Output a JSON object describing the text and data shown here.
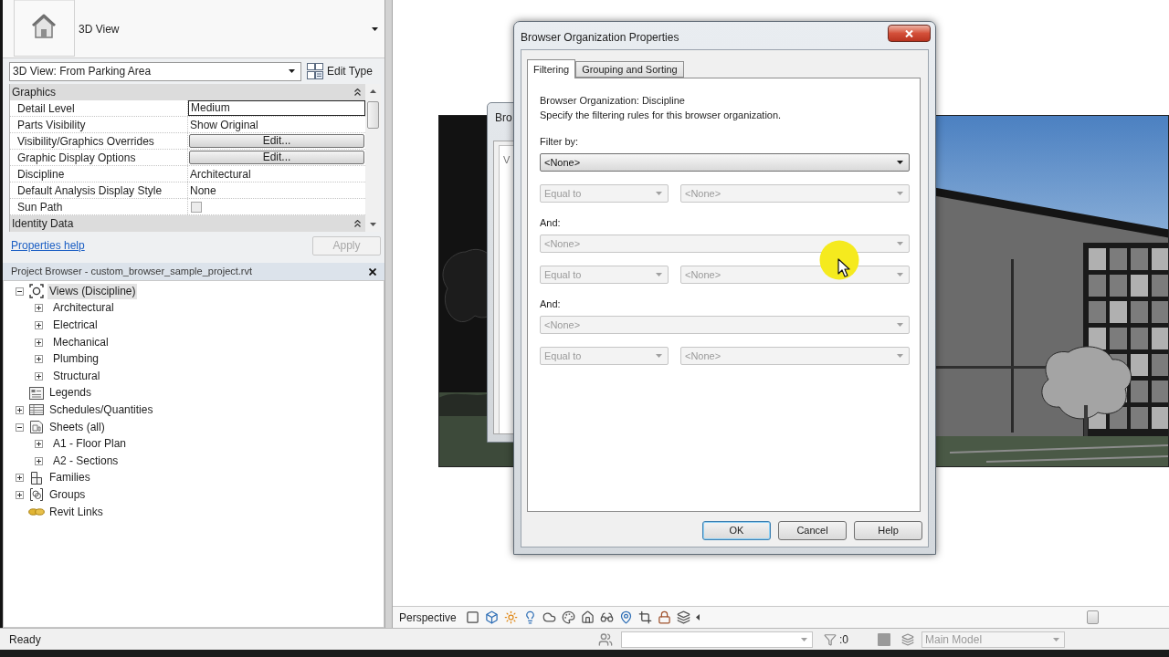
{
  "properties": {
    "type_selector": {
      "label": "3D View"
    },
    "instance_dropdown": {
      "value": "3D View: From Parking Area"
    },
    "edit_type_button": {
      "label": "Edit Type"
    },
    "groups": [
      {
        "title": "Graphics",
        "expanded": true,
        "rows": [
          {
            "label": "Detail Level",
            "kind": "field",
            "value": "Medium"
          },
          {
            "label": "Parts Visibility",
            "kind": "text",
            "value": "Show Original"
          },
          {
            "label": "Visibility/Graphics Overrides",
            "kind": "button",
            "value": "Edit..."
          },
          {
            "label": "Graphic Display Options",
            "kind": "button",
            "value": "Edit..."
          },
          {
            "label": "Discipline",
            "kind": "text",
            "value": "Architectural"
          },
          {
            "label": "Default Analysis Display Style",
            "kind": "text",
            "value": "None"
          },
          {
            "label": "Sun Path",
            "kind": "checkbox",
            "checked": false
          }
        ]
      },
      {
        "title": "Identity Data",
        "expanded": true
      }
    ],
    "help_link": "Properties help",
    "apply_button": {
      "label": "Apply",
      "disabled": true
    }
  },
  "project_browser": {
    "title": "Project Browser - custom_browser_sample_project.rvt",
    "tree": [
      {
        "label": "Views (Discipline)",
        "kind": "views",
        "expanded": true,
        "selected": true,
        "children": [
          {
            "label": "Architectural",
            "expanded": false,
            "selected": false
          },
          {
            "label": "Electrical",
            "expanded": false,
            "selected": false
          },
          {
            "label": "Mechanical",
            "expanded": false,
            "selected": false
          },
          {
            "label": "Plumbing",
            "expanded": false,
            "selected": false
          },
          {
            "label": "Structural",
            "expanded": false,
            "selected": false
          }
        ]
      },
      {
        "label": "Legends",
        "kind": "legends",
        "selected": false
      },
      {
        "label": "Schedules/Quantities",
        "kind": "schedules",
        "expanded": false,
        "selected": false
      },
      {
        "label": "Sheets (all)",
        "kind": "sheets",
        "expanded": true,
        "selected": false,
        "children": [
          {
            "label": "A1 - Floor Plan",
            "expanded": false,
            "selected": false
          },
          {
            "label": "A2 - Sections",
            "expanded": false,
            "selected": false
          }
        ]
      },
      {
        "label": "Families",
        "kind": "families",
        "expanded": false,
        "selected": false
      },
      {
        "label": "Groups",
        "kind": "groups",
        "expanded": false,
        "selected": false
      },
      {
        "label": "Revit Links",
        "kind": "links",
        "selected": false
      }
    ]
  },
  "view_bar": {
    "label": "Perspective"
  },
  "background_dialog": {
    "title": "Bro",
    "content": "V"
  },
  "dialog": {
    "title": "Browser Organization Properties",
    "tabs": [
      {
        "label": "Filtering",
        "selected": true
      },
      {
        "label": "Grouping and Sorting",
        "selected": false
      }
    ],
    "heading": "Browser Organization: Discipline",
    "description": "Specify the filtering rules for this browser organization.",
    "rules": [
      {
        "label": "Filter by:",
        "field": {
          "value": "<None>",
          "disabled": false
        },
        "operator": {
          "value": "Equal to",
          "disabled": true
        },
        "operand": {
          "value": "<None>",
          "disabled": true
        }
      },
      {
        "label": "And:",
        "field": {
          "value": "<None>",
          "disabled": true
        },
        "operator": {
          "value": "Equal to",
          "disabled": true
        },
        "operand": {
          "value": "<None>",
          "disabled": true
        }
      },
      {
        "label": "And:",
        "field": {
          "value": "<None>",
          "disabled": true
        },
        "operator": {
          "value": "Equal to",
          "disabled": true
        },
        "operand": {
          "value": "<None>",
          "disabled": true
        }
      }
    ],
    "buttons": [
      {
        "label": "OK",
        "default": true
      },
      {
        "label": "Cancel",
        "default": false
      },
      {
        "label": "Help",
        "default": false
      }
    ]
  },
  "status_bar": {
    "message": "Ready",
    "filter_count": ":0",
    "model_select": {
      "value": "Main Model",
      "disabled": true
    }
  }
}
